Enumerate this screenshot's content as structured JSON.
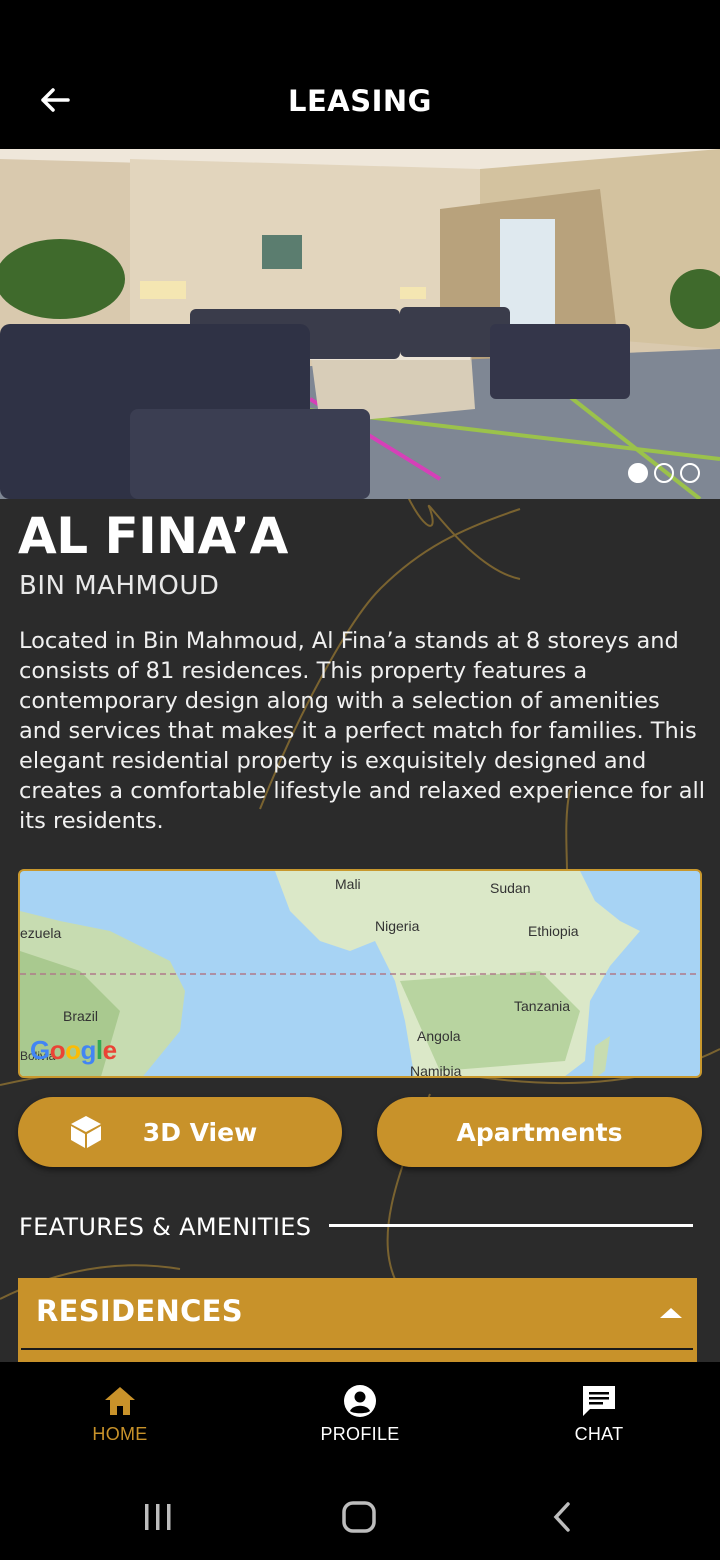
{
  "header": {
    "title": "LEASING"
  },
  "property": {
    "name": "AL FINA’A",
    "location": "BIN MAHMOUD",
    "description": "Located in Bin Mahmoud, Al Fina’a stands at 8 storeys and consists of 81 residences. This property features a contemporary design along with a selection of amenities and services that makes it a perfect match for families. This elegant residential property is exquisitely designed and creates a comfortable lifestyle and relaxed experience for all its residents."
  },
  "carousel": {
    "active_index": 0,
    "count": 3
  },
  "map": {
    "labels": {
      "mali": "Mali",
      "sudan": "Sudan",
      "venezuela": "ezuela",
      "nigeria": "Nigeria",
      "ethiopia": "Ethiopia",
      "brazil": "Brazil",
      "tanzania": "Tanzania",
      "angola": "Angola",
      "bolivia": "Bolivia",
      "namibia": "Namibia"
    },
    "logo": "Google"
  },
  "buttons": {
    "view3d": "3D View",
    "apartments": "Apartments"
  },
  "features": {
    "heading": "FEATURES & AMENITIES"
  },
  "accordion": {
    "title": "RESIDENCES"
  },
  "bottom_nav": {
    "home": "HOME",
    "profile": "PROFILE",
    "chat": "CHAT"
  },
  "colors": {
    "accent": "#c8922a",
    "background": "#2b2b2b",
    "bar": "#000000"
  }
}
